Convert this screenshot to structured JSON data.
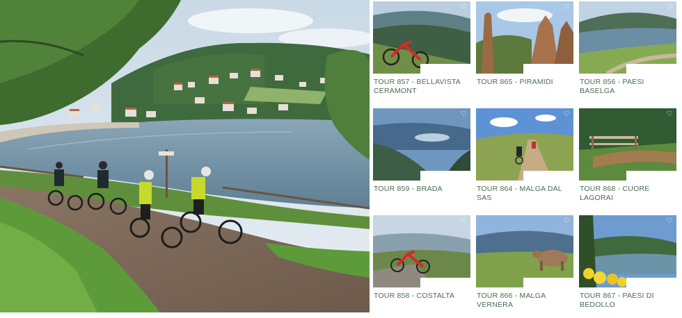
{
  "hero": {
    "photo": "mountain-bikers-lakeside-trail"
  },
  "tours": [
    {
      "label": "TOUR 857 - BELLAVISTA CERAMONT",
      "icon": "heart-icon",
      "scene": "red-bike-overlook"
    },
    {
      "label": "TOUR 865 - PIRAMIDI",
      "icon": "heart-icon",
      "scene": "earth-pyramids"
    },
    {
      "label": "TOUR 856 - PAESI BASELGA",
      "icon": "heart-icon",
      "scene": "lake-road"
    },
    {
      "label": "TOUR 859 - BRADA",
      "icon": "heart-icon",
      "scene": "valley-lake-view"
    },
    {
      "label": "TOUR 864 - MALGA DAL SAS",
      "icon": "heart-icon",
      "scene": "riders-meadow"
    },
    {
      "label": "TOUR 868 - CUORE LAGORAI",
      "icon": "heart-icon",
      "scene": "wooden-bridge"
    },
    {
      "label": "TOUR 858 - COSTALTA",
      "icon": "heart-icon",
      "scene": "red-bike-rocks"
    },
    {
      "label": "TOUR 866 - MALGA VERNERA",
      "icon": "heart-icon",
      "scene": "cow-pasture"
    },
    {
      "label": "TOUR 867 - PAESI DI BEDOLLO",
      "icon": "heart-icon",
      "scene": "flowers-lake"
    }
  ],
  "colors": {
    "label_text": "#4a6b52",
    "sky": "#b9d3ea",
    "forest": "#3e6b3a",
    "lake": "#7f9fb4"
  },
  "heart_glyph": "♡"
}
